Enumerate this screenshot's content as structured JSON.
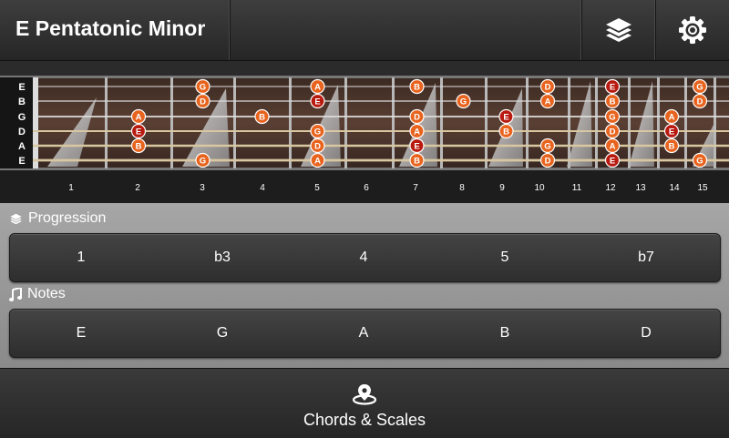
{
  "header": {
    "title": "E Pentatonic Minor",
    "layers_icon": "layers-icon",
    "settings_icon": "gear-icon"
  },
  "fretboard": {
    "strings": [
      "E",
      "B",
      "G",
      "D",
      "A",
      "E"
    ],
    "fret_numbers": [
      "1",
      "2",
      "3",
      "4",
      "5",
      "6",
      "7",
      "8",
      "9",
      "10",
      "11",
      "12",
      "13",
      "14",
      "15"
    ],
    "root_color": "#b81a10",
    "note_color": "#e8641e",
    "notes": [
      {
        "string": 0,
        "fret": 3,
        "note": "G"
      },
      {
        "string": 0,
        "fret": 5,
        "note": "A"
      },
      {
        "string": 0,
        "fret": 7,
        "note": "B"
      },
      {
        "string": 0,
        "fret": 10,
        "note": "D"
      },
      {
        "string": 0,
        "fret": 12,
        "note": "E",
        "root": true
      },
      {
        "string": 0,
        "fret": 15,
        "note": "G"
      },
      {
        "string": 1,
        "fret": 3,
        "note": "D"
      },
      {
        "string": 1,
        "fret": 5,
        "note": "E",
        "root": true
      },
      {
        "string": 1,
        "fret": 8,
        "note": "G"
      },
      {
        "string": 1,
        "fret": 10,
        "note": "A"
      },
      {
        "string": 1,
        "fret": 12,
        "note": "B"
      },
      {
        "string": 1,
        "fret": 15,
        "note": "D"
      },
      {
        "string": 2,
        "fret": 2,
        "note": "A"
      },
      {
        "string": 2,
        "fret": 4,
        "note": "B"
      },
      {
        "string": 2,
        "fret": 7,
        "note": "D"
      },
      {
        "string": 2,
        "fret": 9,
        "note": "E",
        "root": true
      },
      {
        "string": 2,
        "fret": 12,
        "note": "G"
      },
      {
        "string": 2,
        "fret": 14,
        "note": "A"
      },
      {
        "string": 3,
        "fret": 2,
        "note": "E",
        "root": true
      },
      {
        "string": 3,
        "fret": 5,
        "note": "G"
      },
      {
        "string": 3,
        "fret": 7,
        "note": "A"
      },
      {
        "string": 3,
        "fret": 9,
        "note": "B"
      },
      {
        "string": 3,
        "fret": 12,
        "note": "D"
      },
      {
        "string": 3,
        "fret": 14,
        "note": "E",
        "root": true
      },
      {
        "string": 4,
        "fret": 2,
        "note": "B"
      },
      {
        "string": 4,
        "fret": 5,
        "note": "D"
      },
      {
        "string": 4,
        "fret": 7,
        "note": "E",
        "root": true
      },
      {
        "string": 4,
        "fret": 10,
        "note": "G"
      },
      {
        "string": 4,
        "fret": 12,
        "note": "A"
      },
      {
        "string": 4,
        "fret": 14,
        "note": "B"
      },
      {
        "string": 5,
        "fret": 3,
        "note": "G"
      },
      {
        "string": 5,
        "fret": 5,
        "note": "A"
      },
      {
        "string": 5,
        "fret": 7,
        "note": "B"
      },
      {
        "string": 5,
        "fret": 10,
        "note": "D"
      },
      {
        "string": 5,
        "fret": 12,
        "note": "E",
        "root": true
      },
      {
        "string": 5,
        "fret": 15,
        "note": "G"
      }
    ]
  },
  "progression": {
    "label": "Progression",
    "icon": "layers-icon",
    "items": [
      "1",
      "b3",
      "4",
      "5",
      "b7"
    ]
  },
  "notes_section": {
    "label": "Notes",
    "icon": "music-note-icon",
    "items": [
      "E",
      "G",
      "A",
      "B",
      "D"
    ]
  },
  "bottom_nav": {
    "label": "Chords & Scales",
    "icon": "map-pin-icon"
  }
}
